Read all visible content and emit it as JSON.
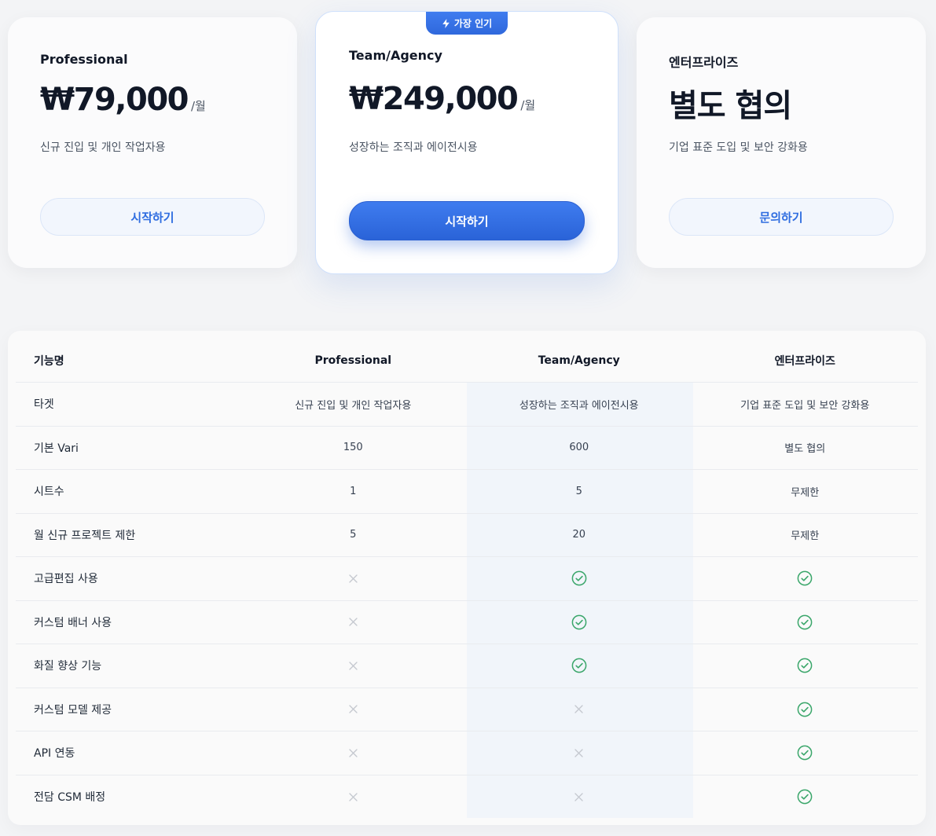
{
  "plans": [
    {
      "name": "Professional",
      "price": "₩79,000",
      "period": "/월",
      "description": "신규 진입 및 개인 작업자용",
      "button_label": "시작하기"
    },
    {
      "name": "Team/Agency",
      "badge": "가장 인기",
      "price": "₩249,000",
      "period": "/월",
      "description": "성장하는 조직과 에이전시용",
      "button_label": "시작하기"
    },
    {
      "name": "엔터프라이즈",
      "price": "별도 협의",
      "description": "기업 표준 도입 및 보안 강화용",
      "button_label": "문의하기"
    }
  ],
  "table": {
    "headers": [
      "기능명",
      "Professional",
      "Team/Agency",
      "엔터프라이즈"
    ],
    "rows": [
      {
        "feature": "타겟",
        "values": [
          "신규 진입 및 개인 작업자용",
          "성장하는 조직과 에이전시용",
          "기업 표준 도입 및 보안 강화용"
        ]
      },
      {
        "feature": "기본 Vari",
        "values": [
          "150",
          "600",
          "별도 협의"
        ]
      },
      {
        "feature": "시트수",
        "values": [
          "1",
          "5",
          "무제한"
        ]
      },
      {
        "feature": "월 신규 프로젝트 제한",
        "values": [
          "5",
          "20",
          "무제한"
        ]
      },
      {
        "feature": "고급편집 사용",
        "values": [
          false,
          true,
          true
        ]
      },
      {
        "feature": "커스텀 배너 사용",
        "values": [
          false,
          true,
          true
        ]
      },
      {
        "feature": "화질 향상 기능",
        "values": [
          false,
          true,
          true
        ]
      },
      {
        "feature": "커스텀 모델 제공",
        "values": [
          false,
          false,
          true
        ]
      },
      {
        "feature": "API 연동",
        "values": [
          false,
          false,
          true
        ]
      },
      {
        "feature": "전담 CSM 배정",
        "values": [
          false,
          false,
          true
        ]
      }
    ]
  },
  "icons": {
    "included": "check-circle-icon",
    "excluded": "x-icon",
    "badge": "lightning-icon"
  },
  "colors": {
    "accent": "#2f6de0",
    "check": "#3aa66a",
    "excluded": "#c4c8cf",
    "highlight_column": "#f1f5fa"
  }
}
